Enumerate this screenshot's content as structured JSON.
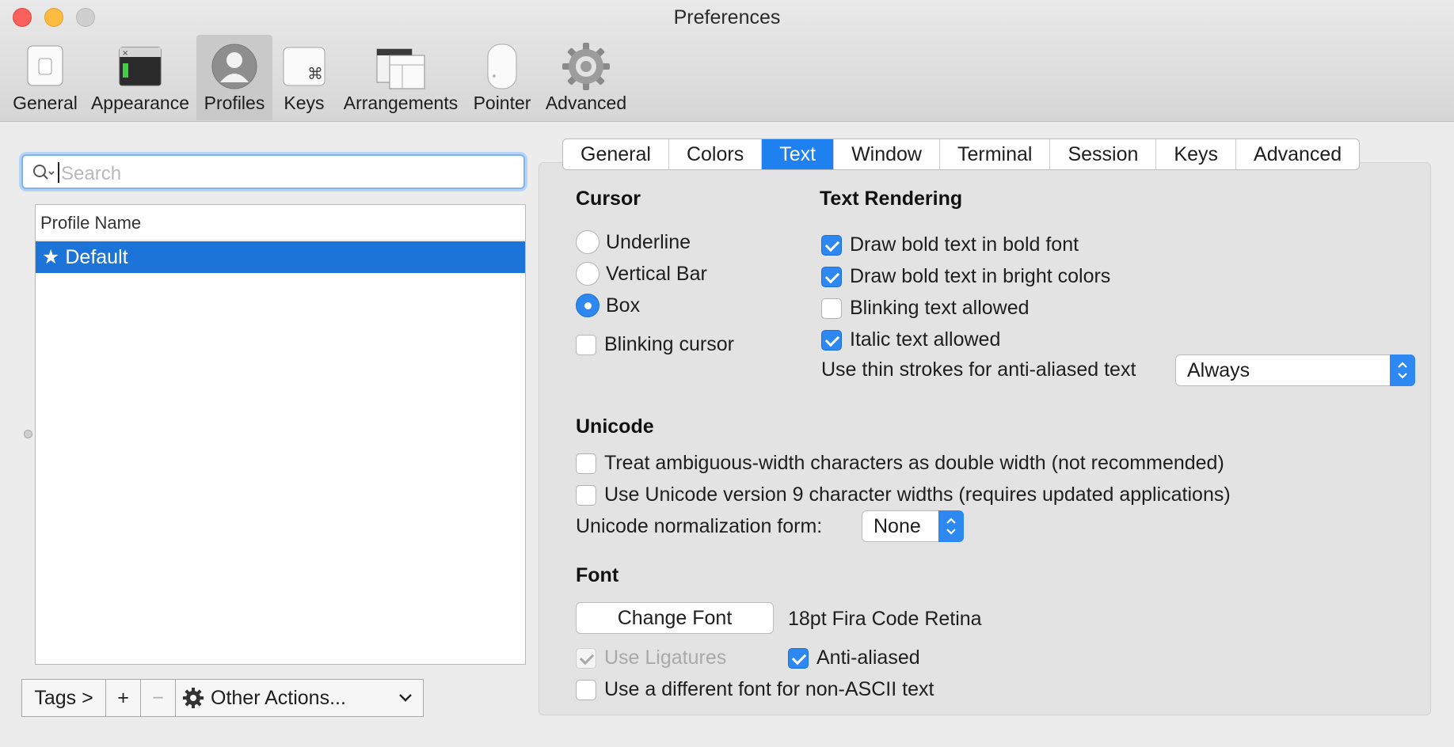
{
  "window": {
    "title": "Preferences"
  },
  "toolbar": {
    "items": [
      {
        "label": "General",
        "icon": "switch-icon"
      },
      {
        "label": "Appearance",
        "icon": "terminal-window-icon"
      },
      {
        "label": "Profiles",
        "icon": "user-silhouette-icon"
      },
      {
        "label": "Keys",
        "icon": "command-key-icon"
      },
      {
        "label": "Arrangements",
        "icon": "window-arrangement-icon"
      },
      {
        "label": "Pointer",
        "icon": "mouse-icon"
      },
      {
        "label": "Advanced",
        "icon": "gear-icon"
      }
    ],
    "selected": "Profiles"
  },
  "sidebar": {
    "search_placeholder": "Search",
    "column_header": "Profile Name",
    "profiles": [
      {
        "label": "★ Default",
        "selected": true
      }
    ],
    "bottom": {
      "tags": "Tags >",
      "add": "+",
      "remove": "−",
      "other_actions": "Other Actions..."
    }
  },
  "tabs": [
    "General",
    "Colors",
    "Text",
    "Window",
    "Terminal",
    "Session",
    "Keys",
    "Advanced"
  ],
  "active_tab": "Text",
  "cursor": {
    "title": "Cursor",
    "options": [
      "Underline",
      "Vertical Bar",
      "Box"
    ],
    "selected": "Box",
    "blinking_label": "Blinking cursor",
    "blinking": false
  },
  "text_rendering": {
    "title": "Text Rendering",
    "bold_font": "Draw bold text in bold font",
    "bold_bright": "Draw bold text in bright colors",
    "blinking_text": "Blinking text allowed",
    "italic": "Italic text allowed",
    "thin_strokes_label": "Use thin strokes for anti-aliased text",
    "thin_strokes_value": "Always"
  },
  "unicode": {
    "title": "Unicode",
    "ambiguous": "Treat ambiguous-width characters as double width (not recommended)",
    "v9": "Use Unicode version 9 character widths (requires updated applications)",
    "normalization_label": "Unicode normalization form:",
    "normalization_value": "None"
  },
  "font": {
    "title": "Font",
    "change_button": "Change Font",
    "current": "18pt Fira Code Retina",
    "ligatures": "Use Ligatures",
    "antialiased": "Anti-aliased",
    "non_ascii": "Use a different font for non-ASCII text"
  },
  "colors": {
    "accent": "#2e88f2",
    "selection": "#1c74d9"
  }
}
